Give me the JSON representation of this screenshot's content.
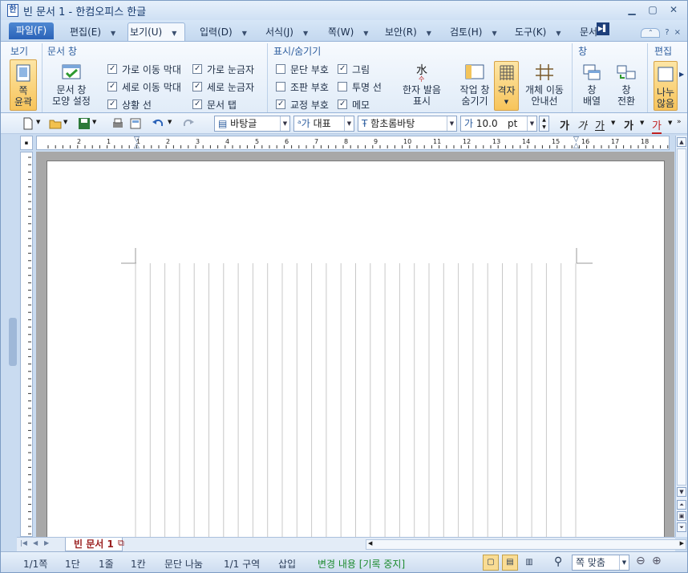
{
  "window": {
    "title": "빈 문서 1 - 한컴오피스 한글",
    "app_icon": "hangul-doc-icon",
    "controls": [
      "minimize-icon",
      "restore-icon",
      "close-icon"
    ]
  },
  "tabs": {
    "file": "파일(F)",
    "items": [
      "편집(E)",
      "보기(U)",
      "입력(D)",
      "서식(J)",
      "쪽(W)",
      "보안(R)",
      "검토(H)",
      "도구(K)",
      "문서"
    ],
    "active": "보기(U)",
    "help_labels": [
      "?",
      "×"
    ]
  },
  "ribbon": {
    "groups": {
      "view": "보기",
      "doc_window": "문서 창",
      "show_hide": "표시/숨기기",
      "window": "창",
      "edit": "편집"
    },
    "buttons": {
      "page_outline": "쪽\n윤곽",
      "doc_window_style": "문서 창\n모양 설정",
      "hanja_reading": "한자 발음\n표시",
      "hide_task_window": "작업 창\n숨기기",
      "grid": "격자",
      "object_move_guide": "개체 이동\n안내선",
      "window_arrange": "창\n배열",
      "window_switch": "창\n전환",
      "split_label": "나누\n않음"
    },
    "checks": [
      {
        "label": "가로 이동 막대",
        "checked": true
      },
      {
        "label": "세로 이동 막대",
        "checked": true
      },
      {
        "label": "상황 선",
        "checked": true
      },
      {
        "label": "가로 눈금자",
        "checked": true
      },
      {
        "label": "세로 눈금자",
        "checked": true
      },
      {
        "label": "문서 탭",
        "checked": true
      },
      {
        "label": "문단 부호",
        "checked": false
      },
      {
        "label": "조판 부호",
        "checked": false
      },
      {
        "label": "교정 부호",
        "checked": true
      },
      {
        "label": "그림",
        "checked": true
      },
      {
        "label": "투명 선",
        "checked": false
      },
      {
        "label": "메모",
        "checked": true
      }
    ]
  },
  "toolbar": {
    "style": "바탕글",
    "language": "대표",
    "font": "함초롬바탕",
    "size": "10.0",
    "size_unit": "pt",
    "format_buttons": [
      "가",
      "가",
      "가",
      "가",
      "가"
    ]
  },
  "ruler": {
    "numbers": [
      "2",
      "1",
      "1",
      "2",
      "3",
      "4",
      "5",
      "6",
      "7",
      "8",
      "9",
      "10",
      "11",
      "12",
      "13",
      "14",
      "15",
      "16",
      "17",
      "18"
    ]
  },
  "document_tab": "빈 문서 1",
  "status": {
    "page": "1/1쪽",
    "column": "1단",
    "line": "1줄",
    "cell": "1칸",
    "paragraph": "문단 나눔",
    "section": "1/1 구역",
    "insert": "삽입",
    "tracking": "변경 내용 [기록 중지]",
    "zoom": "쪽 맞춤"
  },
  "colors": {
    "accent": "#2a62b8",
    "tracking_text": "#1c8a2e",
    "doc_tab_text": "#9a2020"
  }
}
